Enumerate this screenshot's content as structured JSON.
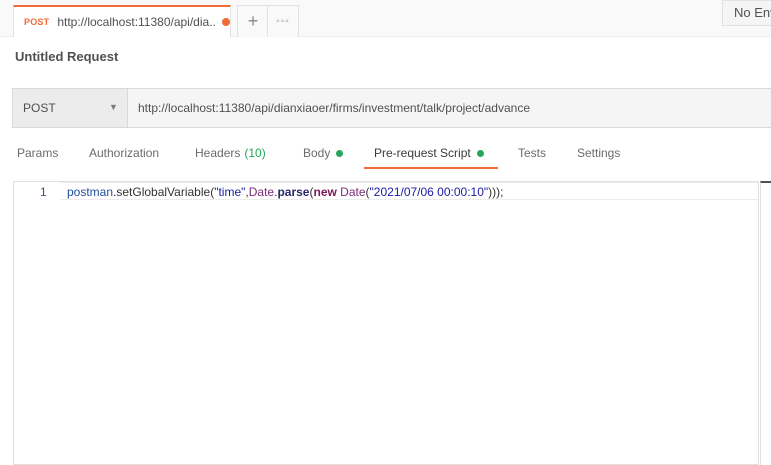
{
  "tabs": [
    {
      "method": "POST",
      "url": "http://localhost:11380/api/dia...",
      "unsaved": true
    }
  ],
  "tab_actions": {
    "new_tab_icon": "plus-icon",
    "more_icon": "ellipsis-icon",
    "new_tab_glyph": "+",
    "more_glyph": "◦◦◦"
  },
  "environment": {
    "selected": "No Env"
  },
  "request": {
    "title": "Untitled Request",
    "method": "POST",
    "method_chevron": "▼",
    "url": "http://localhost:11380/api/dianxiaoer/firms/investment/talk/project/advance"
  },
  "request_tabs": [
    {
      "label": "Params"
    },
    {
      "label": "Authorization"
    },
    {
      "label": "Headers",
      "count": "(10)"
    },
    {
      "label": "Body",
      "indicator": true
    },
    {
      "label": "Pre-request Script",
      "indicator": true,
      "active": true
    },
    {
      "label": "Tests"
    },
    {
      "label": "Settings"
    }
  ],
  "editor": {
    "line_numbers": [
      "1"
    ],
    "line1": {
      "p1": "postman",
      "p2": ".setGlobalVariable(",
      "p3": "\"time\"",
      "p4": ",",
      "p5": "Date",
      "p6": ".",
      "p7": "parse",
      "p8": "(",
      "p9": "new",
      "p10": " ",
      "p11": "Date",
      "p12": "(",
      "p13": "\"2021/07/06 00:00:10\"",
      "p14": ")));"
    }
  },
  "colors": {
    "accent": "#f26b3a",
    "indicator": "#26a65b"
  }
}
